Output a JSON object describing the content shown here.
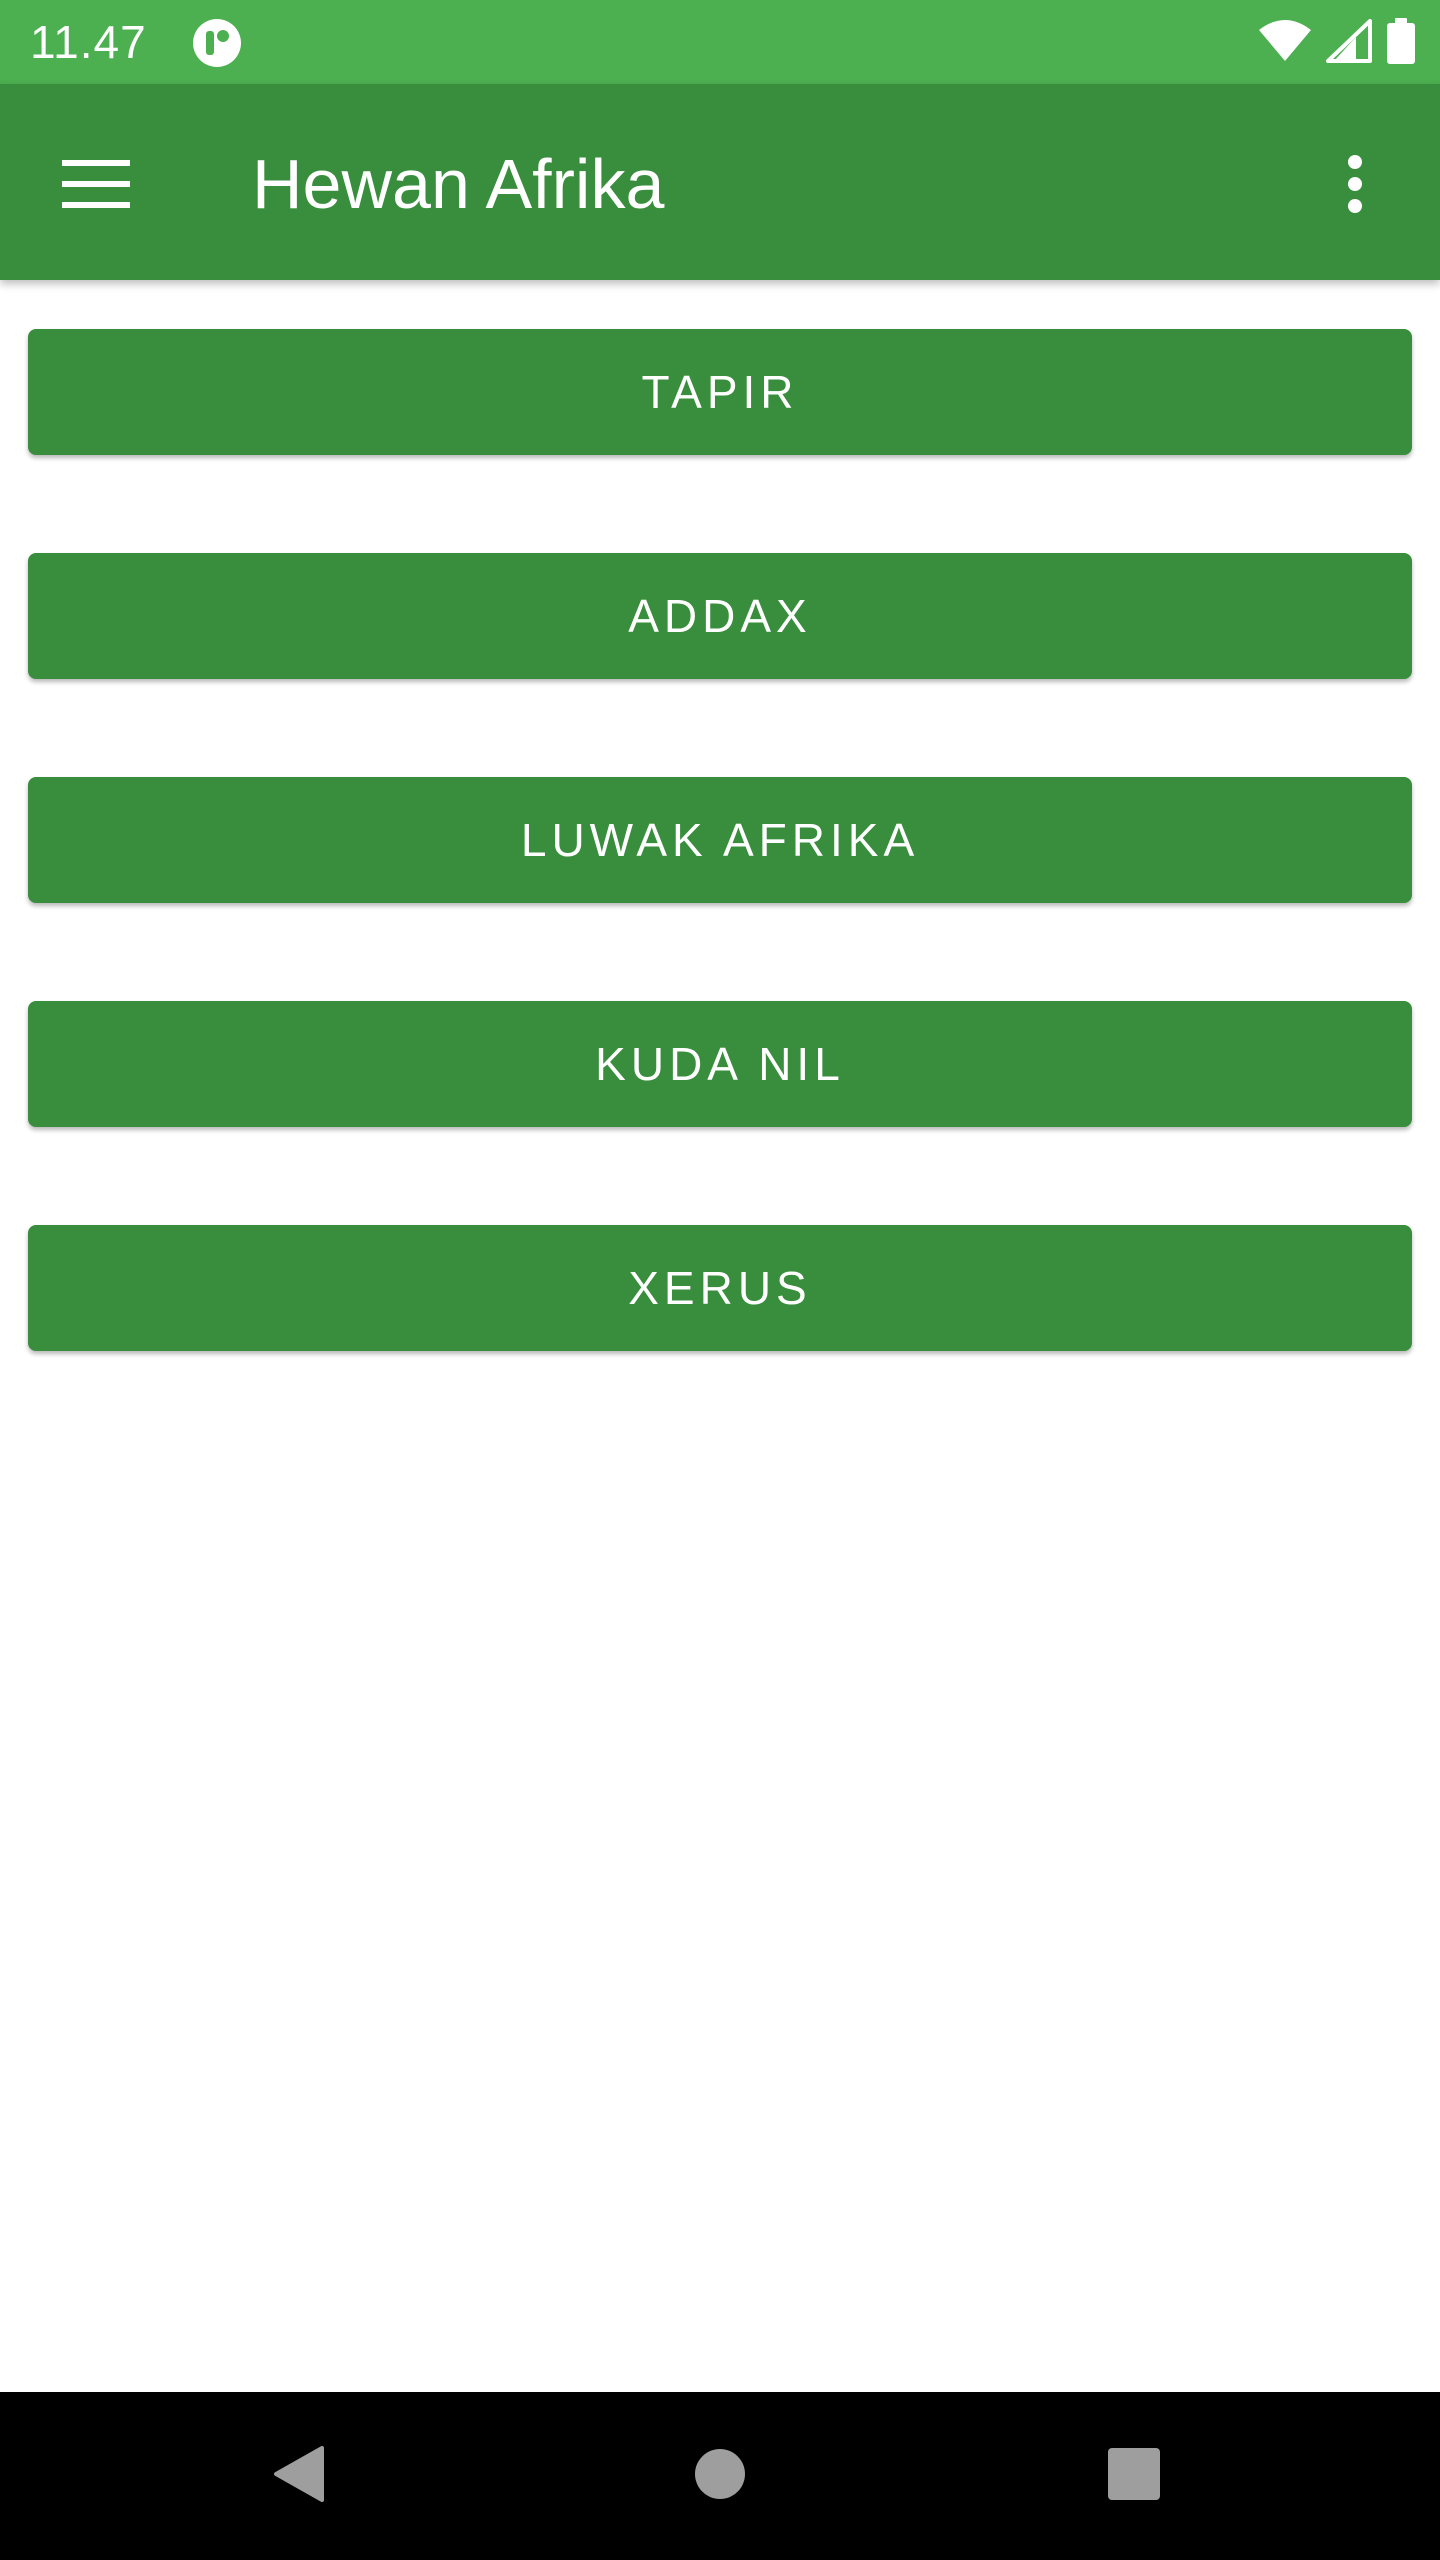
{
  "status_bar": {
    "time": "11.47",
    "icons": [
      "notification-app-icon",
      "wifi-icon",
      "signal-icon",
      "battery-icon"
    ],
    "background_color": "#4caf50"
  },
  "app_bar": {
    "title": "Hewan Afrika",
    "menu_icon": "hamburger-menu-icon",
    "overflow_icon": "more-vert-icon",
    "background_color": "#388e3c"
  },
  "buttons": [
    {
      "label": "TAPIR"
    },
    {
      "label": "ADDAX"
    },
    {
      "label": "LUWAK AFRIKA"
    },
    {
      "label": "KUDA NIL"
    },
    {
      "label": "XERUS"
    }
  ],
  "button_color": "#388e3c",
  "nav_bar": {
    "icons": [
      "back-icon",
      "home-icon",
      "recents-icon"
    ]
  }
}
